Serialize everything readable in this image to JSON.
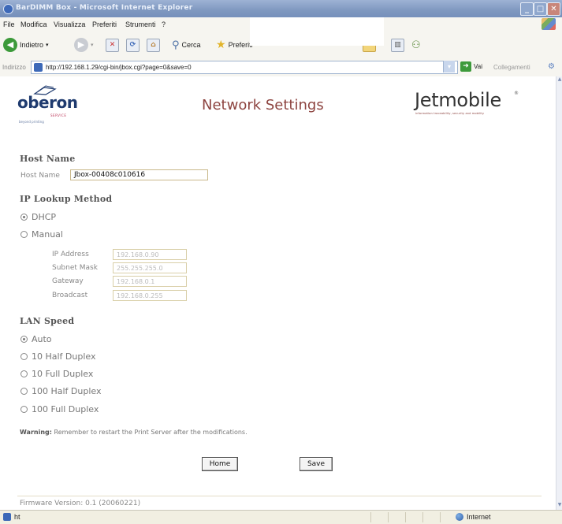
{
  "window": {
    "title": "BarDIMM Box - Microsoft Internet Explorer",
    "minimize": "_",
    "maximize": "□",
    "close": "✕"
  },
  "menubar": [
    "File",
    "Modifica",
    "Visualizza",
    "Preferiti",
    "Strumenti",
    "?"
  ],
  "toolbar": {
    "back_label": "Indietro",
    "search_label": "Cerca",
    "favorites_label": "Preferiti"
  },
  "addressbar": {
    "label": "Indirizzo",
    "url": "http://192.168.1.29/cgi-bin/jbox.cgi?page=0&save=0",
    "go_label": "Vai",
    "links_label": "Collegamenti"
  },
  "header": {
    "left_logo": {
      "word": "oberon",
      "service": "SERVICE",
      "tagline": "beyond printing"
    },
    "title": "Network Settings",
    "right_logo": {
      "word": "Jetmobile",
      "mark": "®",
      "tagline": "information traceability, security and mobility"
    }
  },
  "host": {
    "section": "Host Name",
    "label": "Host Name",
    "value": "Jbox-00408c010616"
  },
  "ip": {
    "section": "IP Lookup Method",
    "options": [
      {
        "label": "DHCP",
        "selected": true
      },
      {
        "label": "Manual",
        "selected": false
      }
    ],
    "fields": [
      {
        "label": "IP Address",
        "value": "192.168.0.90"
      },
      {
        "label": "Subnet Mask",
        "value": "255.255.255.0"
      },
      {
        "label": "Gateway",
        "value": "192.168.0.1"
      },
      {
        "label": "Broadcast",
        "value": "192.168.0.255"
      }
    ]
  },
  "lan": {
    "section": "LAN Speed",
    "options": [
      {
        "label": "Auto",
        "selected": true
      },
      {
        "label": "10 Half Duplex",
        "selected": false
      },
      {
        "label": "10 Full Duplex",
        "selected": false
      },
      {
        "label": "100 Half Duplex",
        "selected": false
      },
      {
        "label": "100 Full Duplex",
        "selected": false
      }
    ]
  },
  "warning": {
    "prefix": "Warning:",
    "text": "Remember to restart the Print Server after the modifications."
  },
  "buttons": {
    "home": "Home",
    "save": "Save"
  },
  "footer": {
    "firmware": "Firmware Version: 0.1 (20060221)"
  },
  "statusbar": {
    "left": "ht",
    "zone": "Internet"
  },
  "colors": {
    "title": "#8d4440",
    "input_border": "#c9b88a",
    "titlebar": "#7f98c0"
  }
}
